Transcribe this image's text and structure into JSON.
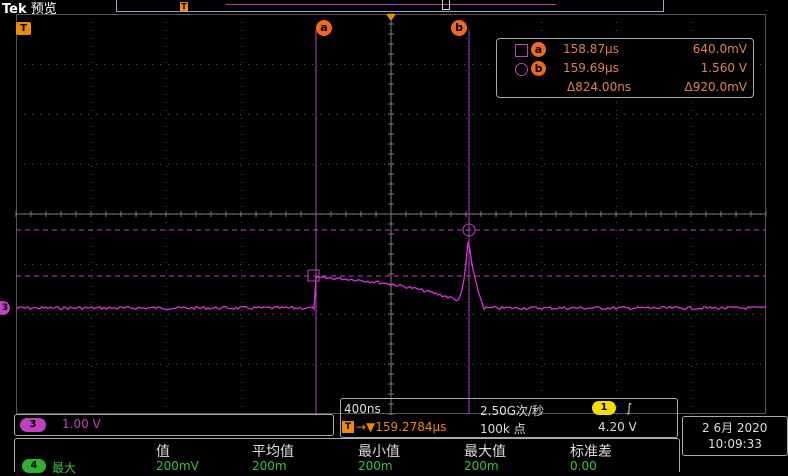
{
  "header": {
    "brand": "Tek",
    "mode": "预览"
  },
  "record": {
    "trigger_glyph": "T"
  },
  "markers": {
    "trigger_level": "T",
    "cursor_a": "a",
    "cursor_b": "b",
    "channel": "3"
  },
  "cursor_readout": {
    "a": {
      "badge": "a",
      "time": "158.87µs",
      "value": "640.0mV"
    },
    "b": {
      "badge": "b",
      "time": "159.69µs",
      "value": "1.560 V"
    },
    "delta": {
      "time": "Δ824.00ns",
      "value": "Δ920.0mV"
    }
  },
  "channel3": {
    "badge": "3",
    "scale": "1.00 V"
  },
  "horizontal": {
    "timebase": "400ns",
    "sample_rate": "2.50G次/秒",
    "trigger_badge": "T",
    "position": "→▼159.2784µs",
    "record_length": "100k 点",
    "trigger_source_badge": "1",
    "trigger_slope": "∫",
    "trigger_level": "4.20 V"
  },
  "datetime": {
    "date": "2 6月 2020",
    "time": "10:09:33"
  },
  "measurements": {
    "headers": [
      "值",
      "平均值",
      "最小值",
      "最大值",
      "标准差"
    ],
    "row": {
      "badge": "4",
      "name": "最大",
      "values": [
        "200mV",
        "200m",
        "200m",
        "200m",
        "0.00"
      ]
    }
  },
  "colors": {
    "trace": "#e030e0",
    "cursor": "#b040c0",
    "cursor_level": "#c040c0",
    "accent_orange": "#f06a1e",
    "trigger_orange": "#f08a00",
    "channel1_yellow": "#f0e000",
    "measure_green": "#3fc03f"
  }
}
